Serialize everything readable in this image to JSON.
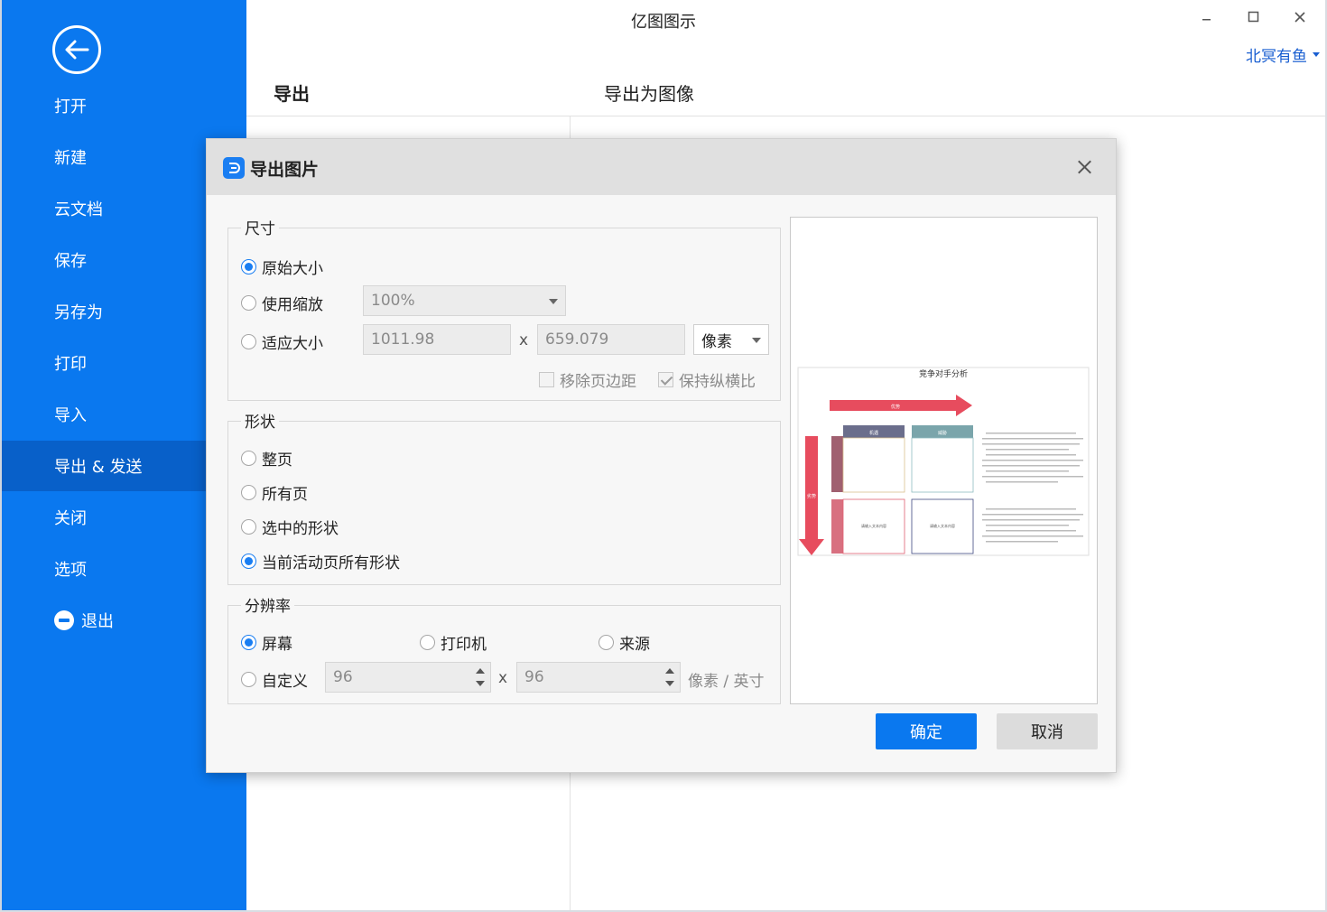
{
  "app": {
    "title": "亿图图示",
    "user": "北冥有鱼"
  },
  "sidebar": {
    "items": [
      {
        "label": "打开"
      },
      {
        "label": "新建"
      },
      {
        "label": "云文档"
      },
      {
        "label": "保存"
      },
      {
        "label": "另存为"
      },
      {
        "label": "打印"
      },
      {
        "label": "导入"
      },
      {
        "label": "导出 & 发送",
        "active": true
      },
      {
        "label": "关闭"
      },
      {
        "label": "选项"
      },
      {
        "label": "退出"
      }
    ]
  },
  "page": {
    "section_title": "导出",
    "subsection_title": "导出为图像"
  },
  "dialog": {
    "title": "导出图片",
    "size": {
      "label": "尺寸",
      "original_label": "原始大小",
      "scale_label": "使用缩放",
      "scale_value": "100%",
      "fit_label": "适应大小",
      "width_value": "1011.98",
      "times": "x",
      "height_value": "659.079",
      "unit_value": "像素",
      "remove_margin_label": "移除页边距",
      "keep_ratio_label": "保持纵横比",
      "selected": "original"
    },
    "shape": {
      "label": "形状",
      "options": [
        "整页",
        "所有页",
        "选中的形状",
        "当前活动页所有形状"
      ],
      "selected": "当前活动页所有形状"
    },
    "resolution": {
      "label": "分辨率",
      "screen_label": "屏幕",
      "printer_label": "打印机",
      "source_label": "来源",
      "custom_label": "自定义",
      "dpi_x": "96",
      "times": "x",
      "dpi_y": "96",
      "unit": "像素 / 英寸",
      "selected": "screen"
    },
    "preview": {
      "title": "竞争对手分析",
      "arrow_h_label": "优势",
      "arrow_v_label": "劣势",
      "col_headers": [
        "机遇",
        "威胁"
      ],
      "cell_texts": [
        "请输入文本内容",
        "请输入文本内容"
      ]
    },
    "ok_label": "确定",
    "cancel_label": "取消"
  },
  "colors": {
    "accent": "#0a78ef",
    "sidebar_active": "#0860c9"
  }
}
